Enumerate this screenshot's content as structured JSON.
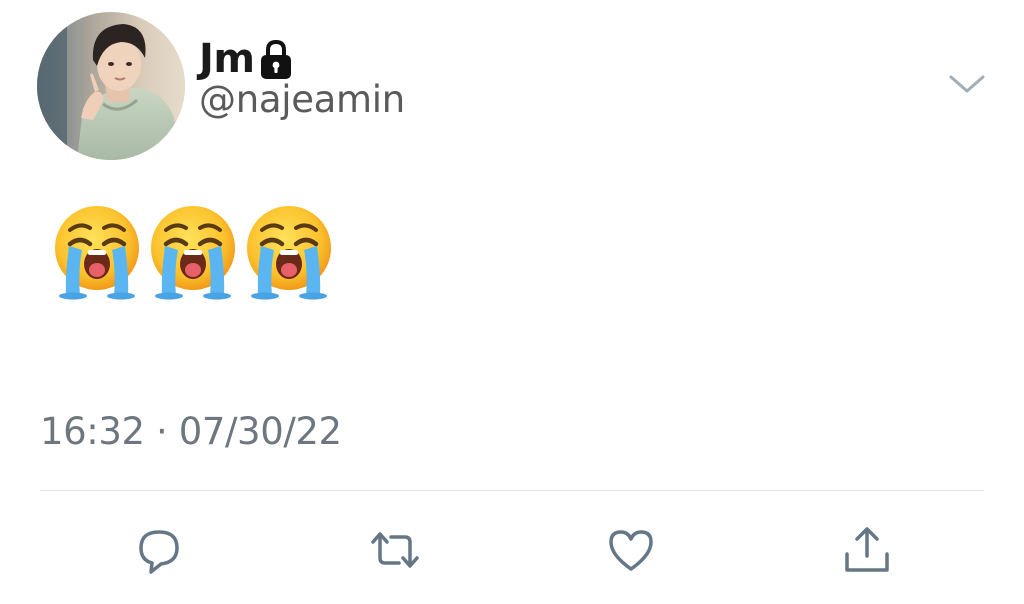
{
  "author": {
    "display_name": "Jm",
    "handle": "@najeamin",
    "protected": true
  },
  "tweet": {
    "text": "😭😭😭",
    "emoji_count": 3,
    "timestamp": "16:32 · 07/30/22"
  },
  "icons": {
    "lock": "lock-icon",
    "more": "chevron-down-icon",
    "reply": "reply-icon",
    "retweet": "retweet-icon",
    "like": "heart-icon",
    "share": "share-icon"
  },
  "colors": {
    "text_primary": "#1a1a1a",
    "text_secondary": "#6e7780",
    "icon": "#657786",
    "divider": "#e1e6ea"
  }
}
